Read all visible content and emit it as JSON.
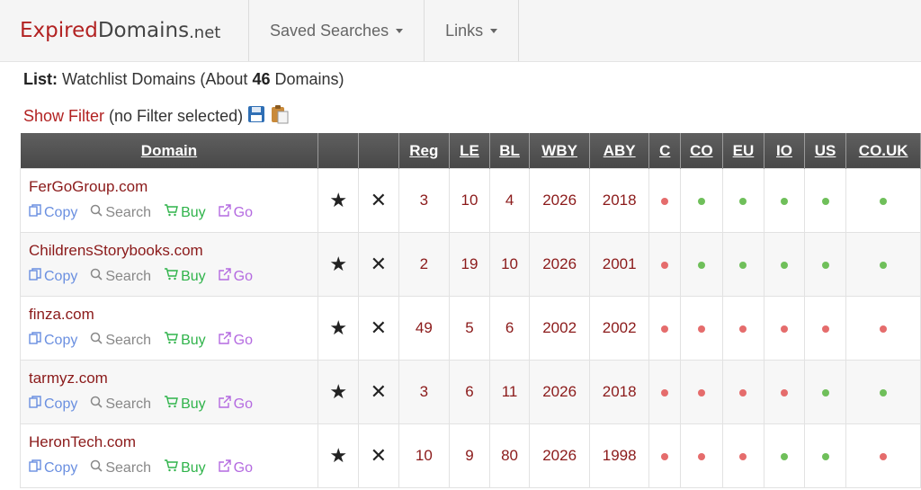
{
  "header": {
    "logo_expired": "Expired",
    "logo_domains": "Domains",
    "logo_net": ".net",
    "nav_saved": "Saved Searches",
    "nav_links": "Links"
  },
  "list": {
    "prefix": "List:",
    "text_before": "Watchlist Domains (About",
    "count": "46",
    "text_after": "Domains)"
  },
  "filter": {
    "show": "Show Filter",
    "status": "(no Filter selected)"
  },
  "columns": [
    "Domain",
    "",
    "",
    "Reg",
    "LE",
    "BL",
    "WBY",
    "ABY",
    "C",
    "CO",
    "EU",
    "IO",
    "US",
    "CO.UK"
  ],
  "actions": {
    "copy": "Copy",
    "search": "Search",
    "buy": "Buy",
    "go": "Go"
  },
  "rows": [
    {
      "domain": "FerGoGroup.com",
      "reg": "3",
      "le": "10",
      "bl": "4",
      "wby": "2026",
      "aby": "2018",
      "status": [
        "red",
        "green",
        "green",
        "green",
        "green",
        "green"
      ]
    },
    {
      "domain": "ChildrensStorybooks.com",
      "reg": "2",
      "le": "19",
      "bl": "10",
      "wby": "2026",
      "aby": "2001",
      "status": [
        "red",
        "green",
        "green",
        "green",
        "green",
        "green"
      ]
    },
    {
      "domain": "finza.com",
      "reg": "49",
      "le": "5",
      "bl": "6",
      "wby": "2002",
      "aby": "2002",
      "status": [
        "red",
        "red",
        "red",
        "red",
        "red",
        "red"
      ]
    },
    {
      "domain": "tarmyz.com",
      "reg": "3",
      "le": "6",
      "bl": "11",
      "wby": "2026",
      "aby": "2018",
      "status": [
        "red",
        "red",
        "red",
        "red",
        "green",
        "green"
      ]
    },
    {
      "domain": "HeronTech.com",
      "reg": "10",
      "le": "9",
      "bl": "80",
      "wby": "2026",
      "aby": "1998",
      "status": [
        "red",
        "red",
        "red",
        "green",
        "green",
        "red"
      ]
    }
  ],
  "colors": {
    "brand_red": "#b22222",
    "link_dark_red": "#8b1a1a",
    "status_red": "#e56c6c",
    "status_green": "#6fbf5a"
  }
}
